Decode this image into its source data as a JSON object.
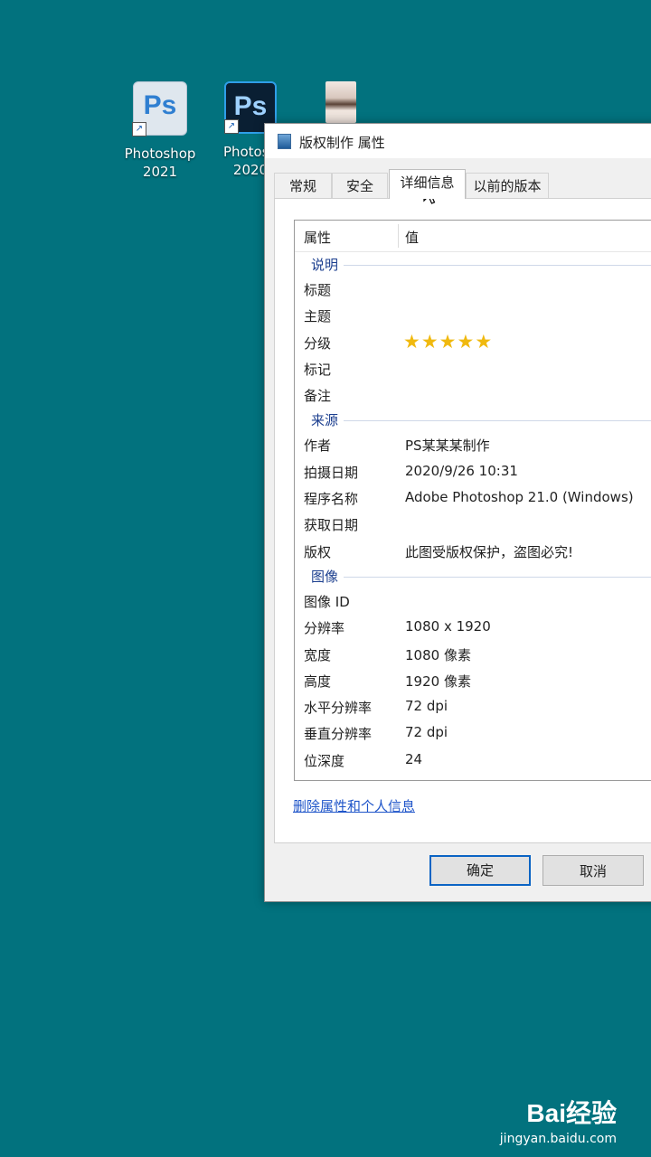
{
  "desktop": {
    "icons": [
      {
        "label_line1": "Photoshop",
        "label_line2": "2021",
        "glyph": "Ps"
      },
      {
        "label_line1": "Photosh",
        "label_line2": "2020",
        "glyph": "Ps"
      },
      {
        "label_line1": "",
        "label_line2": ""
      }
    ]
  },
  "dialog": {
    "title": "版权制作 属性",
    "tabs": [
      "常规",
      "安全",
      "详细信息",
      "以前的版本"
    ],
    "active_tab": "详细信息",
    "list": {
      "header": {
        "property": "属性",
        "value": "值"
      },
      "groups": [
        {
          "name": "说明",
          "rows": [
            {
              "k": "标题",
              "v": ""
            },
            {
              "k": "主题",
              "v": ""
            },
            {
              "k": "分级",
              "v": "",
              "stars": 5
            },
            {
              "k": "标记",
              "v": ""
            },
            {
              "k": "备注",
              "v": ""
            }
          ]
        },
        {
          "name": "来源",
          "rows": [
            {
              "k": "作者",
              "v": "PS某某某制作"
            },
            {
              "k": "拍摄日期",
              "v": "2020/9/26 10:31"
            },
            {
              "k": "程序名称",
              "v": "Adobe Photoshop 21.0 (Windows)"
            },
            {
              "k": "获取日期",
              "v": ""
            },
            {
              "k": "版权",
              "v": "此图受版权保护，盗图必究!"
            }
          ]
        },
        {
          "name": "图像",
          "rows": [
            {
              "k": "图像 ID",
              "v": ""
            },
            {
              "k": "分辨率",
              "v": "1080 x 1920"
            },
            {
              "k": "宽度",
              "v": "1080 像素"
            },
            {
              "k": "高度",
              "v": "1920 像素"
            },
            {
              "k": "水平分辨率",
              "v": "72 dpi"
            },
            {
              "k": "垂直分辨率",
              "v": "72 dpi"
            },
            {
              "k": "位深度",
              "v": "24"
            }
          ]
        }
      ]
    },
    "remove_link": "删除属性和个人信息",
    "buttons": {
      "ok": "确定",
      "cancel": "取消"
    }
  },
  "watermark": {
    "logo": "Bai经验",
    "url": "jingyan.baidu.com"
  }
}
